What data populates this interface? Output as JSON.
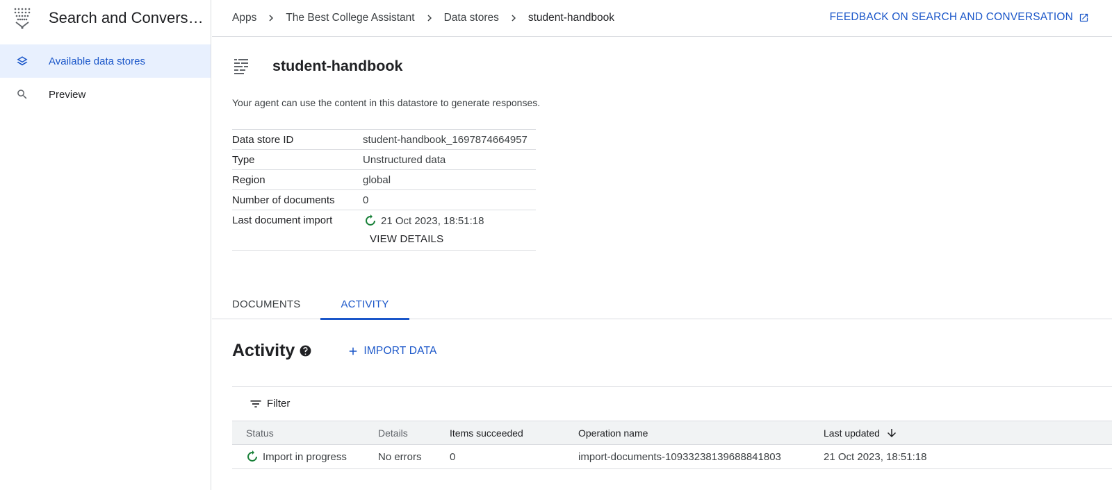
{
  "app": {
    "product_name": "Search and Conversation",
    "product_icon": "vertex-search-logo-icon"
  },
  "sidebar": {
    "items": [
      {
        "label": "Available data stores",
        "icon": "layers-icon",
        "active": true
      },
      {
        "label": "Preview",
        "icon": "search-icon",
        "active": false
      }
    ]
  },
  "breadcrumb": {
    "items": [
      "Apps",
      "The Best College Assistant",
      "Data stores",
      "student-handbook"
    ]
  },
  "header": {
    "feedback_label": "FEEDBACK ON SEARCH AND CONVERSATION"
  },
  "datastore": {
    "title": "student-handbook",
    "description": "Your agent can use the content in this datastore to generate responses.",
    "fields": [
      {
        "label": "Data store ID",
        "value": "student-handbook_1697874664957"
      },
      {
        "label": "Type",
        "value": "Unstructured data"
      },
      {
        "label": "Region",
        "value": "global"
      },
      {
        "label": "Number of documents",
        "value": "0"
      },
      {
        "label": "Last document import",
        "value": "21 Oct 2023, 18:51:18"
      }
    ],
    "view_details_label": "VIEW DETAILS"
  },
  "tabs": [
    {
      "label": "DOCUMENTS",
      "active": false
    },
    {
      "label": "ACTIVITY",
      "active": true
    }
  ],
  "activity": {
    "title": "Activity",
    "import_label": "IMPORT DATA",
    "filter_label": "Filter",
    "columns": [
      "Status",
      "Details",
      "Items succeeded",
      "Operation name",
      "Last updated"
    ],
    "rows": [
      {
        "status": "Import in progress",
        "details": "No errors",
        "items_succeeded": "0",
        "operation_name": "import-documents-10933238139688841803",
        "last_updated": "21 Oct 2023, 18:51:18"
      }
    ]
  },
  "colors": {
    "accent": "#1a56c9",
    "status_progress": "#188038",
    "active_nav_bg": "#e8f0fe"
  }
}
